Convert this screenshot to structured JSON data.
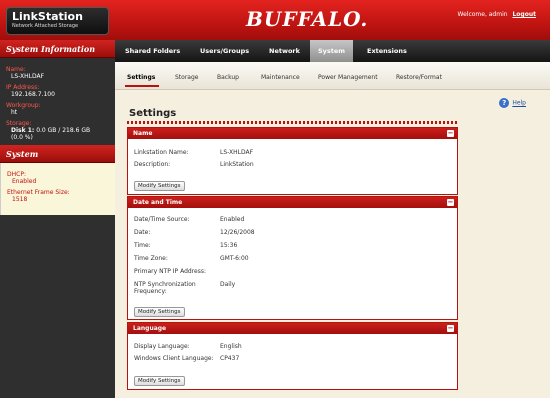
{
  "header": {
    "logo_title": "LinkStation",
    "logo_sub": "Network Attached Storage",
    "brand": "BUFFALO.",
    "welcome": "Welcome, admin",
    "logout": "Logout"
  },
  "topnav": [
    "Shared Folders",
    "Users/Groups",
    "Network",
    "System",
    "Extensions"
  ],
  "subnav": [
    "Settings",
    "Storage",
    "Backup",
    "Maintenance",
    "Power Management",
    "Restore/Format"
  ],
  "sidebar": {
    "info_title": "System Information",
    "name_label": "Name:",
    "name_value": "LS-XHLDAF",
    "ip_label": "IP Address:",
    "ip_value": "192.168.7.100",
    "workgroup_label": "Workgroup:",
    "workgroup_value": "ht",
    "storage_label": "Storage:",
    "storage_disk": "Disk 1:",
    "storage_value": "0.0 GB / 218.6 GB",
    "storage_pct": "(0.0 %)",
    "system_title": "System",
    "dhcp_label": "DHCP:",
    "dhcp_value": "Enabled",
    "frame_label": "Ethernet Frame Size:",
    "frame_value": "1518"
  },
  "main": {
    "title": "Settings",
    "help": "Help",
    "name_section": {
      "title": "Name",
      "ls_label": "Linkstation Name:",
      "ls_value": "LS-XHLDAF",
      "desc_label": "Description:",
      "desc_value": "LinkStation",
      "button": "Modify Settings"
    },
    "date_section": {
      "title": "Date and Time",
      "source_label": "Date/Time Source:",
      "source_value": "Enabled",
      "date_label": "Date:",
      "date_value": "12/26/2008",
      "time_label": "Time:",
      "time_value": "15:36",
      "tz_label": "Time Zone:",
      "tz_value": "GMT-6:00",
      "ntp_label": "Primary NTP IP Address:",
      "sync_label": "NTP Synchronization",
      "sync_label2": "Frequency:",
      "sync_value": "Daily",
      "button": "Modify Settings"
    },
    "lang_section": {
      "title": "Language",
      "display_label": "Display Language:",
      "display_value": "English",
      "win_label": "Windows Client Language:",
      "win_value": "CP437",
      "button": "Modify Settings"
    }
  }
}
